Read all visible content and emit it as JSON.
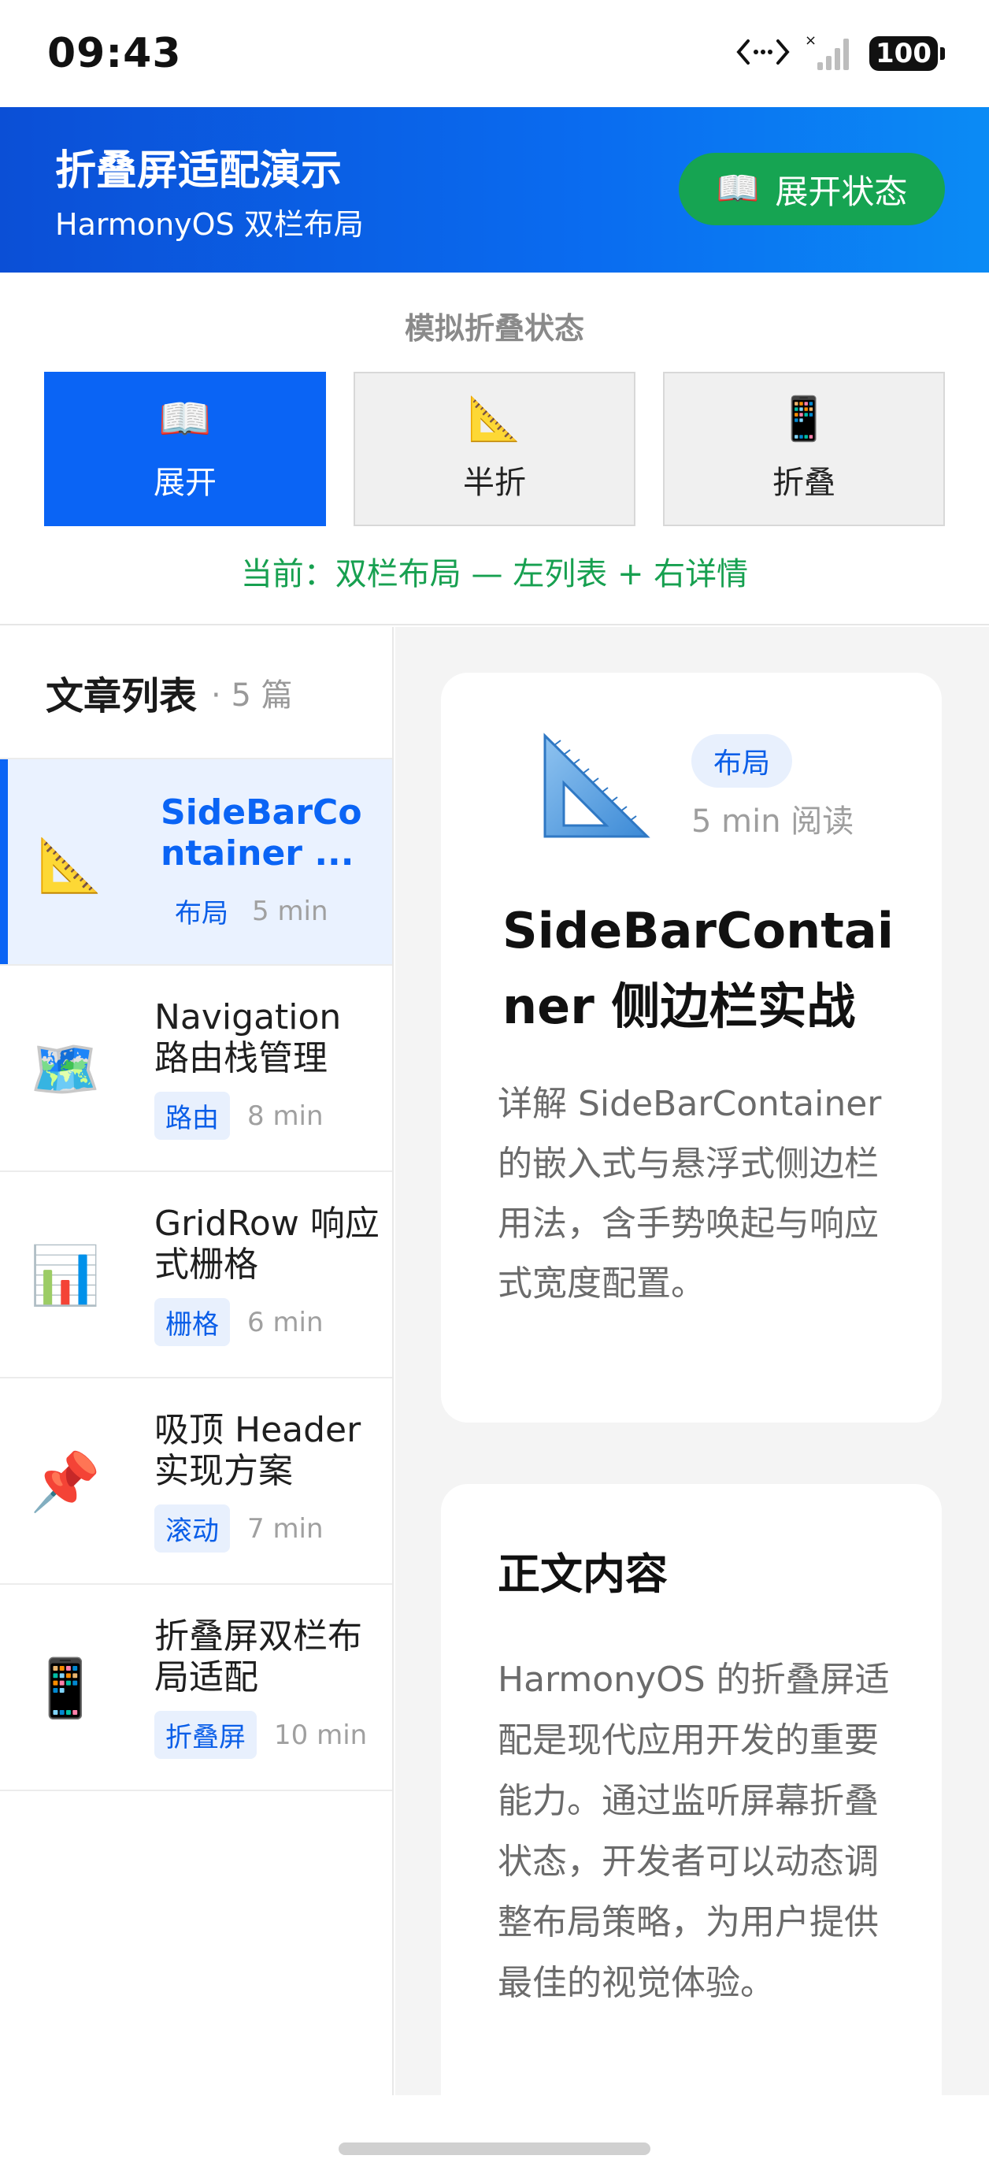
{
  "status_bar": {
    "time": "09:43",
    "battery": "100",
    "icons": [
      "link-arrows-icon",
      "no-signal-icon",
      "battery-icon"
    ]
  },
  "header": {
    "title": "折叠屏适配演示",
    "subtitle": "HarmonyOS 双栏布局",
    "state_pill": {
      "icon": "📖",
      "label": "展开状态"
    }
  },
  "simulator": {
    "title": "模拟折叠状态",
    "buttons": [
      {
        "icon": "📖",
        "label": "展开",
        "active": true
      },
      {
        "icon": "📐",
        "label": "半折",
        "active": false
      },
      {
        "icon": "📱",
        "label": "折叠",
        "active": false
      }
    ],
    "current": "当前：双栏布局 — 左列表 + 右详情"
  },
  "list": {
    "title": "文章列表",
    "count": "· 5 篇",
    "items": [
      {
        "icon": "📐",
        "title": "SideBarCo ntainer ...",
        "tag": "布局",
        "time": "5 min",
        "selected": true
      },
      {
        "icon": "🗺️",
        "title": "Navigation 路由栈管理",
        "tag": "路由",
        "time": "8 min",
        "selected": false
      },
      {
        "icon": "📊",
        "title": "GridRow 响应式栅格",
        "tag": "栅格",
        "time": "6 min",
        "selected": false
      },
      {
        "icon": "📌",
        "title": "吸顶 Header 实现方案",
        "tag": "滚动",
        "time": "7 min",
        "selected": false
      },
      {
        "icon": "📱",
        "title": "折叠屏双栏布局适配",
        "tag": "折叠屏",
        "time": "10 min",
        "selected": false
      }
    ]
  },
  "detail": {
    "icon": "📐",
    "tag": "布局",
    "read_time": "5 min 阅读",
    "title": "SideBarContainer 侧边栏实战",
    "description": "详解 SideBarContainer 的嵌入式与悬浮式侧边栏用法，含手势唤起与响应式宽度配置。"
  },
  "content": {
    "heading": "正文内容",
    "body": "HarmonyOS 的折叠屏适配是现代应用开发的重要能力。通过监听屏幕折叠状态，开发者可以动态调整布局策略，为用户提供最佳的视觉体验。"
  }
}
